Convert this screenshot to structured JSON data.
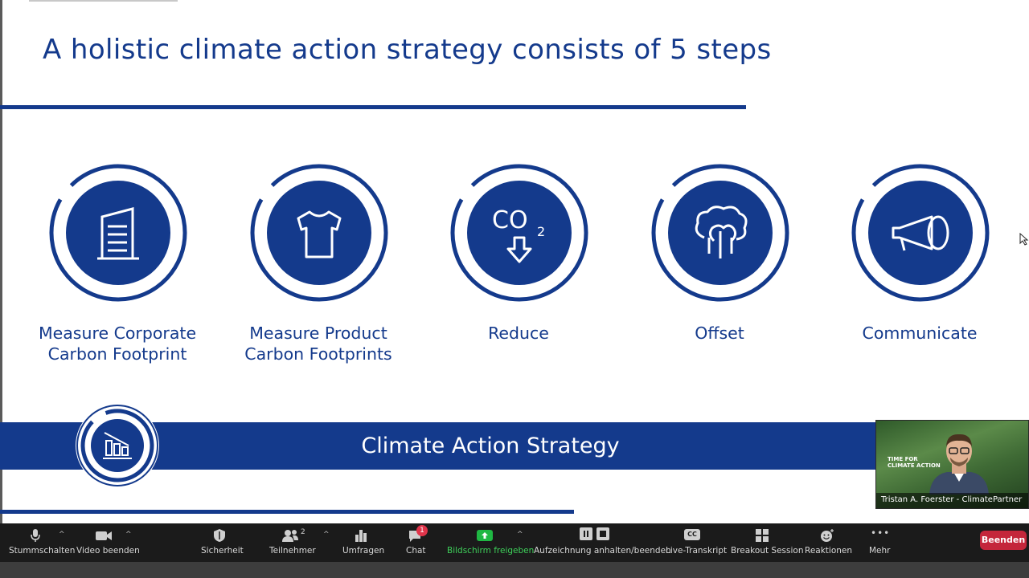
{
  "slide": {
    "title": "A holistic climate action strategy consists of 5 steps",
    "steps": [
      {
        "icon": "building-icon",
        "label_line1": "Measure Corporate",
        "label_line2": "Carbon Footprint"
      },
      {
        "icon": "tshirt-icon",
        "label_line1": "Measure Product",
        "label_line2": "Carbon Footprints"
      },
      {
        "icon": "co2-down-icon",
        "icon_text": "CO",
        "icon_sub": "2",
        "label_line1": "Reduce",
        "label_line2": ""
      },
      {
        "icon": "trees-icon",
        "label_line1": "Offset",
        "label_line2": ""
      },
      {
        "icon": "megaphone-icon",
        "label_line1": "Communicate",
        "label_line2": ""
      }
    ],
    "banner_title": "Climate Action Strategy",
    "colors": {
      "brand": "#143a8c",
      "background": "#ffffff"
    }
  },
  "video": {
    "sign_text": "TIME FOR\nCLIMATE ACTION",
    "participant_name": "Tristan A. Foerster - ClimatePartner"
  },
  "toolbar": {
    "items": [
      {
        "label": "Stummschalten",
        "icon": "microphone-icon"
      },
      {
        "label": "Video beenden",
        "icon": "video-camera-icon"
      },
      {
        "label": "Sicherheit",
        "icon": "shield-icon"
      },
      {
        "label": "Teilnehmer",
        "icon": "participants-icon",
        "count": "2"
      },
      {
        "label": "Umfragen",
        "icon": "poll-icon"
      },
      {
        "label": "Chat",
        "icon": "chat-icon",
        "badge": "1"
      },
      {
        "label": "Bildschirm freigeben",
        "icon": "share-screen-icon"
      },
      {
        "label": "Aufzeichnung anhalten/beenden",
        "icon": "recording-icon"
      },
      {
        "label": "Live-Transkript",
        "icon": "cc-icon",
        "icon_text": "CC"
      },
      {
        "label": "Breakout Session",
        "icon": "breakout-icon"
      },
      {
        "label": "Reaktionen",
        "icon": "emoji-icon"
      },
      {
        "label": "Mehr",
        "icon": "more-icon",
        "icon_text": "•••"
      }
    ],
    "end_label": "Beenden",
    "caret": "^",
    "colors": {
      "share": "#3ed15a",
      "end": "#c4263b",
      "badge": "#e0344a"
    }
  }
}
